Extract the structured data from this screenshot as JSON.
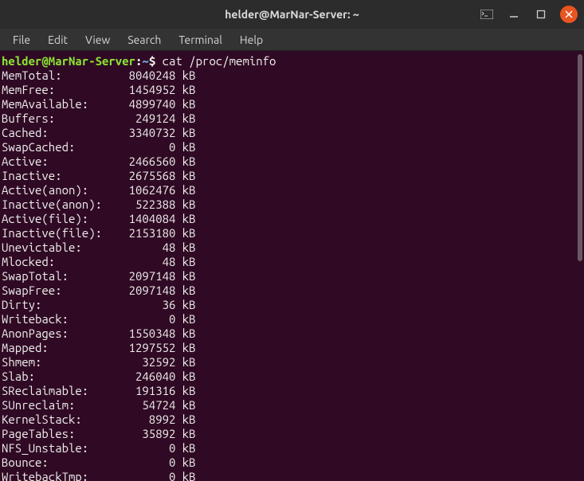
{
  "window": {
    "title": "helder@MarNar-Server: ~"
  },
  "menubar": {
    "items": [
      "File",
      "Edit",
      "View",
      "Search",
      "Terminal",
      "Help"
    ]
  },
  "prompt": {
    "user_host": "helder@MarNar-Server",
    "colon": ":",
    "path": "~",
    "dollar": "$",
    "command": "cat /proc/meminfo"
  },
  "meminfo": [
    {
      "label": "MemTotal:",
      "value": "8040248",
      "unit": "kB"
    },
    {
      "label": "MemFree:",
      "value": "1454952",
      "unit": "kB"
    },
    {
      "label": "MemAvailable:",
      "value": "4899740",
      "unit": "kB"
    },
    {
      "label": "Buffers:",
      "value": "249124",
      "unit": "kB"
    },
    {
      "label": "Cached:",
      "value": "3340732",
      "unit": "kB"
    },
    {
      "label": "SwapCached:",
      "value": "0",
      "unit": "kB"
    },
    {
      "label": "Active:",
      "value": "2466560",
      "unit": "kB"
    },
    {
      "label": "Inactive:",
      "value": "2675568",
      "unit": "kB"
    },
    {
      "label": "Active(anon):",
      "value": "1062476",
      "unit": "kB"
    },
    {
      "label": "Inactive(anon):",
      "value": "522388",
      "unit": "kB"
    },
    {
      "label": "Active(file):",
      "value": "1404084",
      "unit": "kB"
    },
    {
      "label": "Inactive(file):",
      "value": "2153180",
      "unit": "kB"
    },
    {
      "label": "Unevictable:",
      "value": "48",
      "unit": "kB"
    },
    {
      "label": "Mlocked:",
      "value": "48",
      "unit": "kB"
    },
    {
      "label": "SwapTotal:",
      "value": "2097148",
      "unit": "kB"
    },
    {
      "label": "SwapFree:",
      "value": "2097148",
      "unit": "kB"
    },
    {
      "label": "Dirty:",
      "value": "36",
      "unit": "kB"
    },
    {
      "label": "Writeback:",
      "value": "0",
      "unit": "kB"
    },
    {
      "label": "AnonPages:",
      "value": "1550348",
      "unit": "kB"
    },
    {
      "label": "Mapped:",
      "value": "1297552",
      "unit": "kB"
    },
    {
      "label": "Shmem:",
      "value": "32592",
      "unit": "kB"
    },
    {
      "label": "Slab:",
      "value": "246040",
      "unit": "kB"
    },
    {
      "label": "SReclaimable:",
      "value": "191316",
      "unit": "kB"
    },
    {
      "label": "SUnreclaim:",
      "value": "54724",
      "unit": "kB"
    },
    {
      "label": "KernelStack:",
      "value": "8992",
      "unit": "kB"
    },
    {
      "label": "PageTables:",
      "value": "35892",
      "unit": "kB"
    },
    {
      "label": "NFS_Unstable:",
      "value": "0",
      "unit": "kB"
    },
    {
      "label": "Bounce:",
      "value": "0",
      "unit": "kB"
    },
    {
      "label": "WritebackTmp:",
      "value": "0",
      "unit": "kB"
    }
  ],
  "layout": {
    "label_width": 16,
    "value_width": 10
  }
}
